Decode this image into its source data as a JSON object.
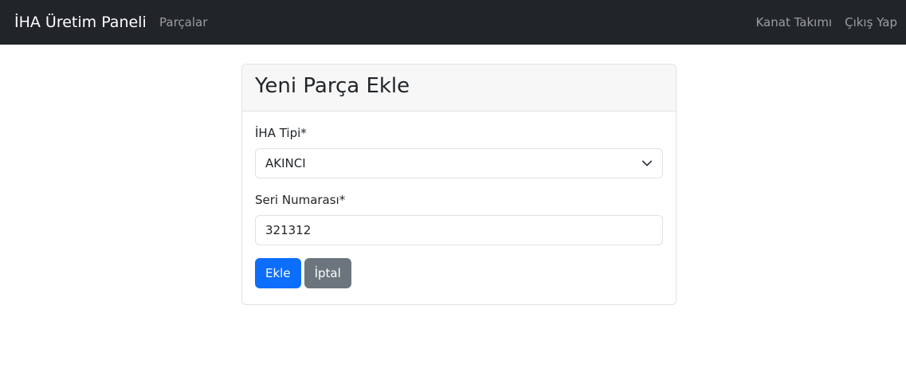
{
  "navbar": {
    "brand": "İHA Üretim Paneli",
    "parts_link": "Parçalar",
    "team_link": "Kanat Takımı",
    "logout_link": "Çıkış Yap"
  },
  "card": {
    "title": "Yeni Parça Ekle",
    "uav_type": {
      "label": "İHA Tipi*",
      "selected": "AKINCI"
    },
    "serial_number": {
      "label": "Seri Numarası*",
      "value": "321312"
    },
    "buttons": {
      "add": "Ekle",
      "cancel": "İptal"
    }
  },
  "colors": {
    "navbar_bg": "#212529",
    "primary": "#0d6efd",
    "secondary": "#6c757d"
  },
  "icons": {
    "select_arrow": "chevron-down-icon"
  }
}
